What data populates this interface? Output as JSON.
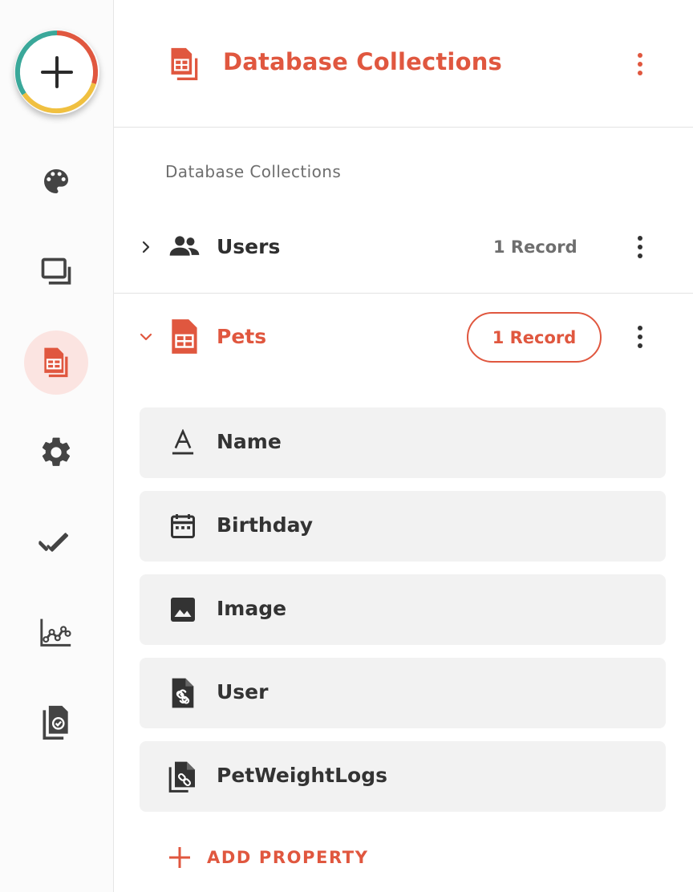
{
  "header": {
    "title": "Database Collections",
    "icon": "table-file-icon"
  },
  "section": {
    "label": "Database Collections"
  },
  "collections": [
    {
      "name": "Users",
      "count": "1 Record",
      "icon": "people-icon",
      "expanded": false
    },
    {
      "name": "Pets",
      "count": "1 Record",
      "icon": "table-file-icon",
      "expanded": true
    }
  ],
  "properties": [
    {
      "label": "Name",
      "icon": "text-type-icon"
    },
    {
      "label": "Birthday",
      "icon": "calendar-icon"
    },
    {
      "label": "Image",
      "icon": "image-icon"
    },
    {
      "label": "User",
      "icon": "file-link-icon"
    },
    {
      "label": "PetWeightLogs",
      "icon": "files-link-icon"
    }
  ],
  "add_property": {
    "label": "ADD PROPERTY"
  },
  "colors": {
    "accent": "#e0573f",
    "icon": "#3b3b3b",
    "muted": "#6e6e6e",
    "active_bg": "#fbe4e1",
    "row_bg": "#f2f2f2"
  }
}
